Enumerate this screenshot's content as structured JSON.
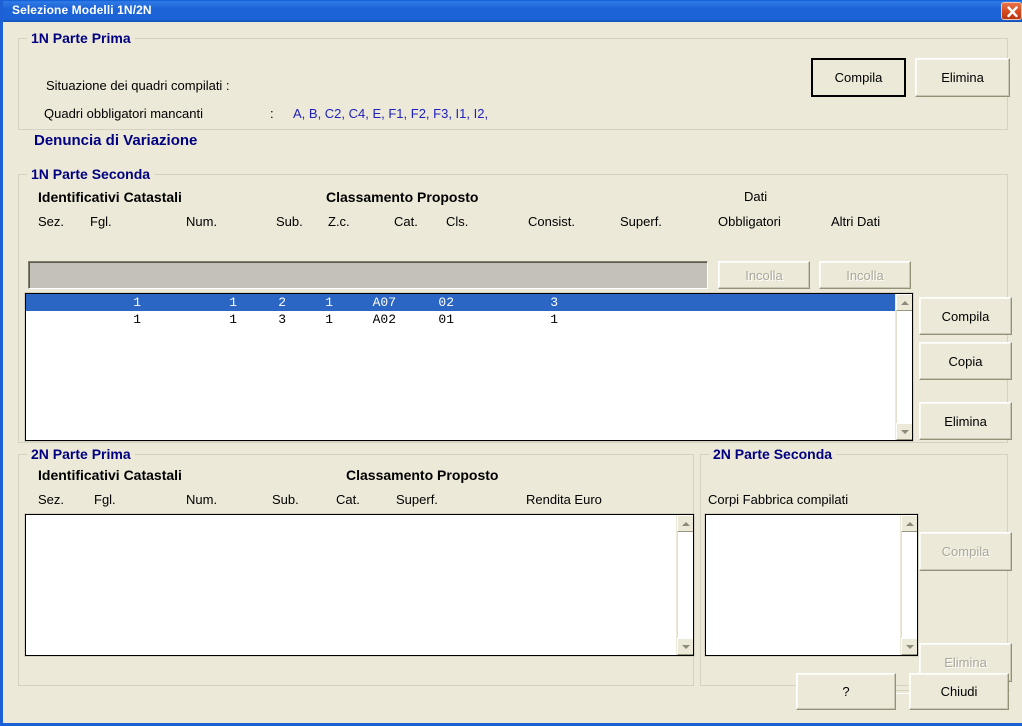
{
  "window": {
    "title": "Selezione Modelli 1N/2N",
    "close_icon": "close-icon",
    "accent_titlebar": "#1b63d6",
    "body_bg": "#ece9d8",
    "caption_color": "#000080",
    "link_color": "#2020c0",
    "selection_color": "#2c66c4"
  },
  "group_1n_prima": {
    "caption": "1N Parte Prima",
    "row1_label": "Situazione dei quadri compilati  :",
    "row2_label": "Quadri obbligatori mancanti",
    "row2_colon": ":",
    "row2_value": "A, B, C2, C4, E, F1, F2, F3, I1, I2,",
    "compila_label": "Compila",
    "elimina_label": "Elimina"
  },
  "subtitle": "Denuncia di Variazione",
  "group_1n_seconda": {
    "caption": "1N Parte Seconda",
    "group_headers": [
      "Identificativi Catastali",
      "Classamento Proposto"
    ],
    "columns": [
      "Sez.",
      "Fgl.",
      "Num.",
      "Sub.",
      "Z.c.",
      "Cat.",
      "Cls.",
      "Consist.",
      "Superf."
    ],
    "dati_obbligatori_header_line1": "Dati",
    "dati_obbligatori_header_line2": "Obbligatori",
    "altri_dati_header": "Altri Dati",
    "incolla_obbligatori_label": "Incolla",
    "incolla_altri_label": "Incolla",
    "input_value": "",
    "rows": [
      {
        "selected": true,
        "sez": "",
        "fgl": "1",
        "num": "1",
        "sub": "2",
        "zc": "1",
        "cat": "A07",
        "cls": "02",
        "consist": "3",
        "superf": ""
      },
      {
        "selected": false,
        "sez": "",
        "fgl": "1",
        "num": "1",
        "sub": "3",
        "zc": "1",
        "cat": "A02",
        "cls": "01",
        "consist": "1",
        "superf": ""
      }
    ],
    "side_buttons": [
      {
        "label": "Compila",
        "disabled": false
      },
      {
        "label": "Copia",
        "disabled": false
      },
      {
        "label": "Elimina",
        "disabled": false
      }
    ]
  },
  "group_2n_prima": {
    "caption": "2N Parte Prima",
    "group_headers": [
      "Identificativi Catastali",
      "Classamento Proposto"
    ],
    "columns": [
      "Sez.",
      "Fgl.",
      "Num.",
      "Sub.",
      "Cat.",
      "Superf.",
      "Rendita Euro"
    ],
    "rows": []
  },
  "group_2n_seconda": {
    "caption": "2N Parte Seconda",
    "list_label": "Corpi Fabbrica compilati",
    "rows": [],
    "compila_label": "Compila",
    "elimina_label": "Elimina",
    "compila_disabled": true,
    "elimina_disabled": true
  },
  "footer": {
    "help_label": "?",
    "close_label": "Chiudi"
  }
}
